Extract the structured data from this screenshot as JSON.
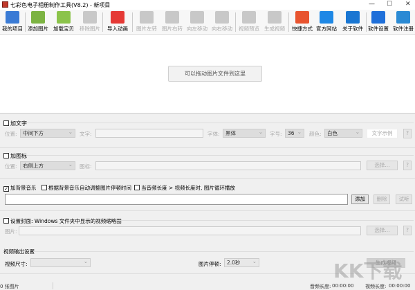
{
  "window": {
    "title": "七彩色电子相册制作工具(V8.2) - 新项目",
    "minimize": "—",
    "maximize": "☐",
    "close": "✕"
  },
  "toolbar": [
    {
      "label": "我的项目",
      "icon": "folder-icon",
      "color": "#3a7bd5",
      "enabled": true
    },
    {
      "label": "添加图片",
      "icon": "add-image-icon",
      "color": "#7cb342",
      "enabled": true
    },
    {
      "label": "加载宝贝",
      "icon": "load-image-icon",
      "color": "#8bc34a",
      "enabled": true
    },
    {
      "label": "移除图片",
      "icon": "remove-image-icon",
      "color": "#bbb",
      "enabled": false
    },
    {
      "label": "导入动画",
      "icon": "import-animation-icon",
      "color": "#e53935",
      "enabled": true
    },
    {
      "label": "图片左转",
      "icon": "rotate-left-icon",
      "color": "#bbb",
      "enabled": false
    },
    {
      "label": "图片右转",
      "icon": "rotate-right-icon",
      "color": "#bbb",
      "enabled": false
    },
    {
      "label": "向左移动",
      "icon": "arrow-left-icon",
      "color": "#bbb",
      "enabled": false
    },
    {
      "label": "向右移动",
      "icon": "arrow-right-icon",
      "color": "#bbb",
      "enabled": false
    },
    {
      "label": "视频预览",
      "icon": "magnifier-icon",
      "color": "#bbb",
      "enabled": false
    },
    {
      "label": "生成视频",
      "icon": "film-icon",
      "color": "#bbb",
      "enabled": false
    },
    {
      "label": "快捷方式",
      "icon": "shortcut-icon",
      "color": "#e8542f",
      "enabled": true
    },
    {
      "label": "官方网站",
      "icon": "ie-icon",
      "color": "#1e88e5",
      "enabled": true
    },
    {
      "label": "关于软件",
      "icon": "info-icon",
      "color": "#1976d2",
      "enabled": true
    },
    {
      "label": "软件设置",
      "icon": "gear-icon",
      "color": "#1e6fd9",
      "enabled": true
    },
    {
      "label": "软件注册",
      "icon": "monitor-icon",
      "color": "#2a8ad4",
      "enabled": true
    }
  ],
  "canvas": {
    "drop_hint": "可以拖动图片文件到这里"
  },
  "text_group": {
    "title": "加文字",
    "checked": false,
    "position_label": "位置:",
    "position": "中间下方",
    "text_label": "文字:",
    "text": "",
    "font_label": "字体:",
    "font": "黑体",
    "size_label": "字号:",
    "size": "36",
    "color_label": "颜色:",
    "color": "白色",
    "sample": "文字示例",
    "help": "?"
  },
  "icon_group": {
    "title": "加图标",
    "checked": false,
    "position_label": "位置:",
    "position": "右侧上方",
    "icon_label": "图标:",
    "icon": "",
    "choose": "选择...",
    "help": "?"
  },
  "music_group": {
    "add_music": "加背景音乐",
    "add_music_checked": true,
    "auto_adjust": "根据背景音乐自动调整图片停顿时间",
    "auto_checked": false,
    "loop": "当音频长度 > 视频长度时, 图片循环播放",
    "loop_checked": false,
    "file": "",
    "add": "添加",
    "delete": "删除",
    "listen": "试听"
  },
  "cover_group": {
    "title": "设置封面: Windows 文件夹中显示的视频缩略图",
    "checked": false,
    "image_label": "图片:",
    "image": "",
    "choose": "选择...",
    "help": "?"
  },
  "output": {
    "title": "视频输出设置",
    "size_label": "视频尺寸:",
    "size": "",
    "pause_label": "图片停顿:",
    "pause": "2.0秒",
    "generate": "生成视频"
  },
  "status": {
    "count": "0 张图片",
    "audio_label": "音频长度:",
    "audio": "00:00:00",
    "video_label": "视频长度:",
    "video": "00:00:00"
  },
  "watermark": "KK下载"
}
